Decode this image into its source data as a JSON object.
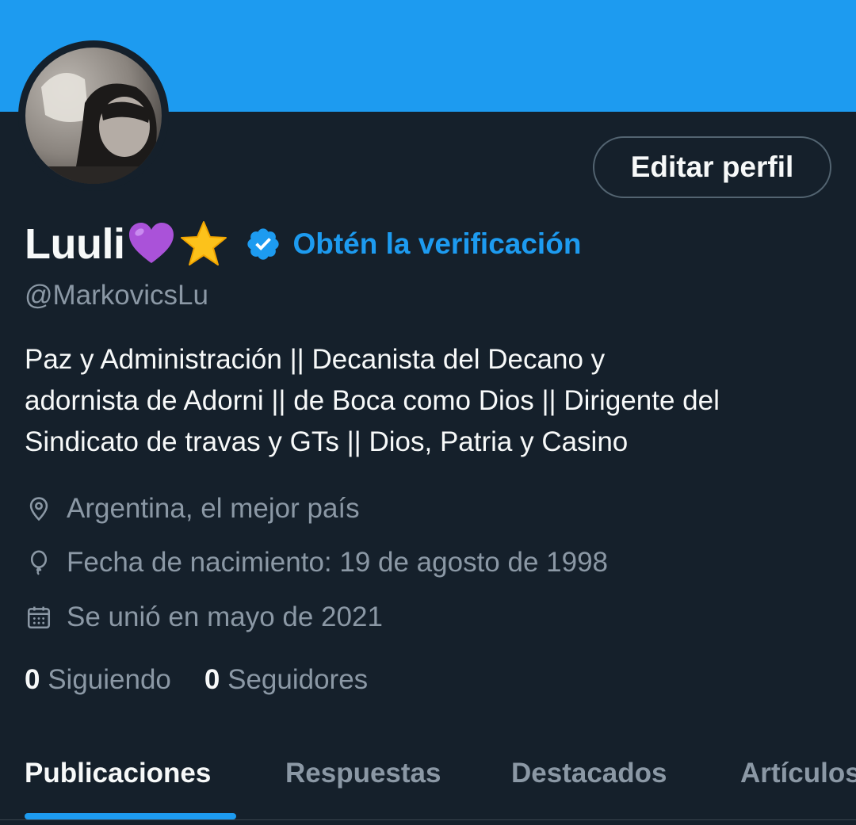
{
  "colors": {
    "banner": "#1d9bf0",
    "background": "#15202b",
    "accent": "#1d9bf0",
    "muted": "#8b98a5"
  },
  "profile": {
    "avatar_icon": "profile-photo",
    "edit_button": "Editar perfil",
    "name": "Luuli",
    "name_emojis": [
      "purple-heart",
      "star"
    ],
    "verified_icon": "verified-badge-icon",
    "get_verified": "Obtén la verificación",
    "handle": "@MarkovicsLu",
    "bio_lines": [
      "Paz y Administración || Decanista del Decano y",
      "adornista de Adorni || de Boca como Dios || Dirigente del",
      "Sindicato de travas y GTs || Dios, Patria y Casino"
    ],
    "location": "Argentina, el mejor país",
    "birthdate": "Fecha de nacimiento: 19 de agosto de 1998",
    "joined": "Se unió en mayo de 2021",
    "following_count": "0",
    "following_label": "Siguiendo",
    "followers_count": "0",
    "followers_label": "Seguidores"
  },
  "tabs": [
    {
      "label": "Publicaciones",
      "active": true
    },
    {
      "label": "Respuestas",
      "active": false
    },
    {
      "label": "Destacados",
      "active": false
    },
    {
      "label": "Artículos",
      "active": false
    }
  ]
}
